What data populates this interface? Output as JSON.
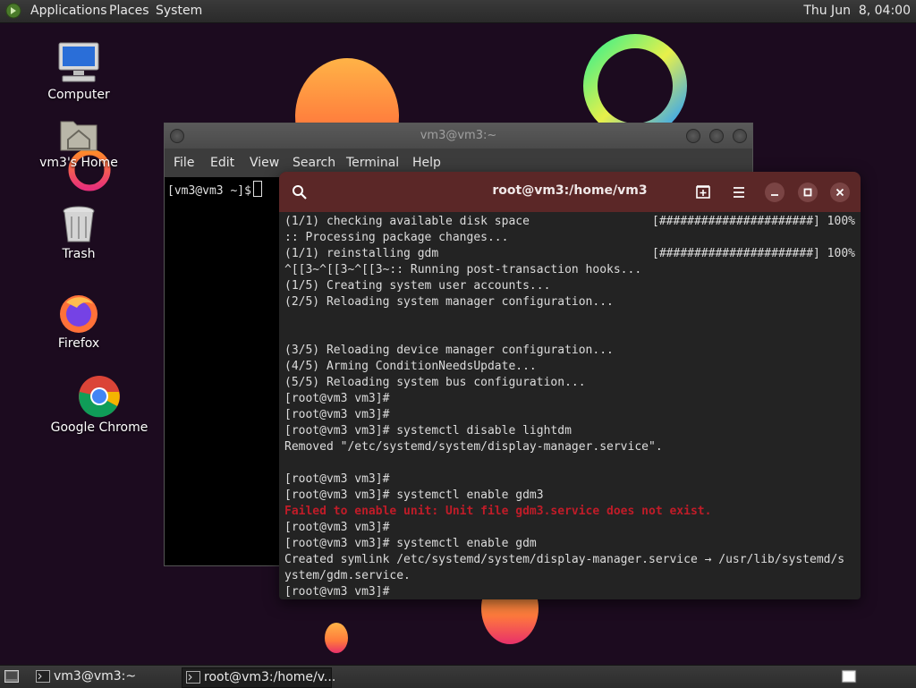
{
  "top_panel": {
    "menus": [
      "Applications",
      "Places",
      "System"
    ],
    "clock": "Thu Jun  8, 04:00"
  },
  "desktop_icons": [
    {
      "label": "Computer",
      "icon": "computer-icon"
    },
    {
      "label": "vm3's Home",
      "icon": "home-folder-icon"
    },
    {
      "label": "Trash",
      "icon": "trash-icon"
    },
    {
      "label": "Firefox",
      "icon": "firefox-icon"
    },
    {
      "label": "Google Chrome",
      "icon": "chrome-icon"
    }
  ],
  "mate_terminal": {
    "title": "vm3@vm3:~",
    "menu": [
      "File",
      "Edit",
      "View",
      "Search",
      "Terminal",
      "Help"
    ],
    "prompt": "[vm3@vm3 ~]$"
  },
  "gnome_terminal": {
    "title": "root@vm3:/home/vm3",
    "lines": [
      {
        "text": "(1/1) checking available disk space",
        "right": "[######################] 100%"
      },
      {
        "text": ":: Processing package changes...",
        "right": ""
      },
      {
        "text": "(1/1) reinstalling gdm",
        "right": "[######################] 100%"
      },
      {
        "text": "^[[3~^[[3~^[[3~:: Running post-transaction hooks...",
        "right": ""
      },
      {
        "text": "(1/5) Creating system user accounts...",
        "right": ""
      },
      {
        "text": "(2/5) Reloading system manager configuration...",
        "right": ""
      },
      {
        "text": "",
        "right": ""
      },
      {
        "text": "",
        "right": ""
      },
      {
        "text": "(3/5) Reloading device manager configuration...",
        "right": ""
      },
      {
        "text": "(4/5) Arming ConditionNeedsUpdate...",
        "right": ""
      },
      {
        "text": "(5/5) Reloading system bus configuration...",
        "right": ""
      },
      {
        "text": "[root@vm3 vm3]#",
        "right": ""
      },
      {
        "text": "[root@vm3 vm3]#",
        "right": ""
      },
      {
        "text": "[root@vm3 vm3]# systemctl disable lightdm",
        "right": ""
      },
      {
        "text": "Removed \"/etc/systemd/system/display-manager.service\".",
        "right": ""
      },
      {
        "text": "",
        "right": ""
      },
      {
        "text": "[root@vm3 vm3]#",
        "right": ""
      },
      {
        "text": "[root@vm3 vm3]# systemctl enable gdm3",
        "right": ""
      },
      {
        "text": "Failed to enable unit: Unit file gdm3.service does not exist.",
        "right": "",
        "error": true
      },
      {
        "text": "[root@vm3 vm3]#",
        "right": ""
      },
      {
        "text": "[root@vm3 vm3]# systemctl enable gdm",
        "right": ""
      },
      {
        "text": "Created symlink /etc/systemd/system/display-manager.service → /usr/lib/systemd/s",
        "right": ""
      },
      {
        "text": "ystem/gdm.service.",
        "right": ""
      },
      {
        "text": "[root@vm3 vm3]#",
        "right": ""
      }
    ]
  },
  "taskbar": {
    "tasks": [
      {
        "label": "vm3@vm3:~",
        "active": false
      },
      {
        "label": "root@vm3:/home/v...",
        "active": true
      }
    ]
  },
  "colors": {
    "header_bg": "#5b2727",
    "error_text": "#c01c28",
    "desktop_bg": "#1c0b1f"
  }
}
